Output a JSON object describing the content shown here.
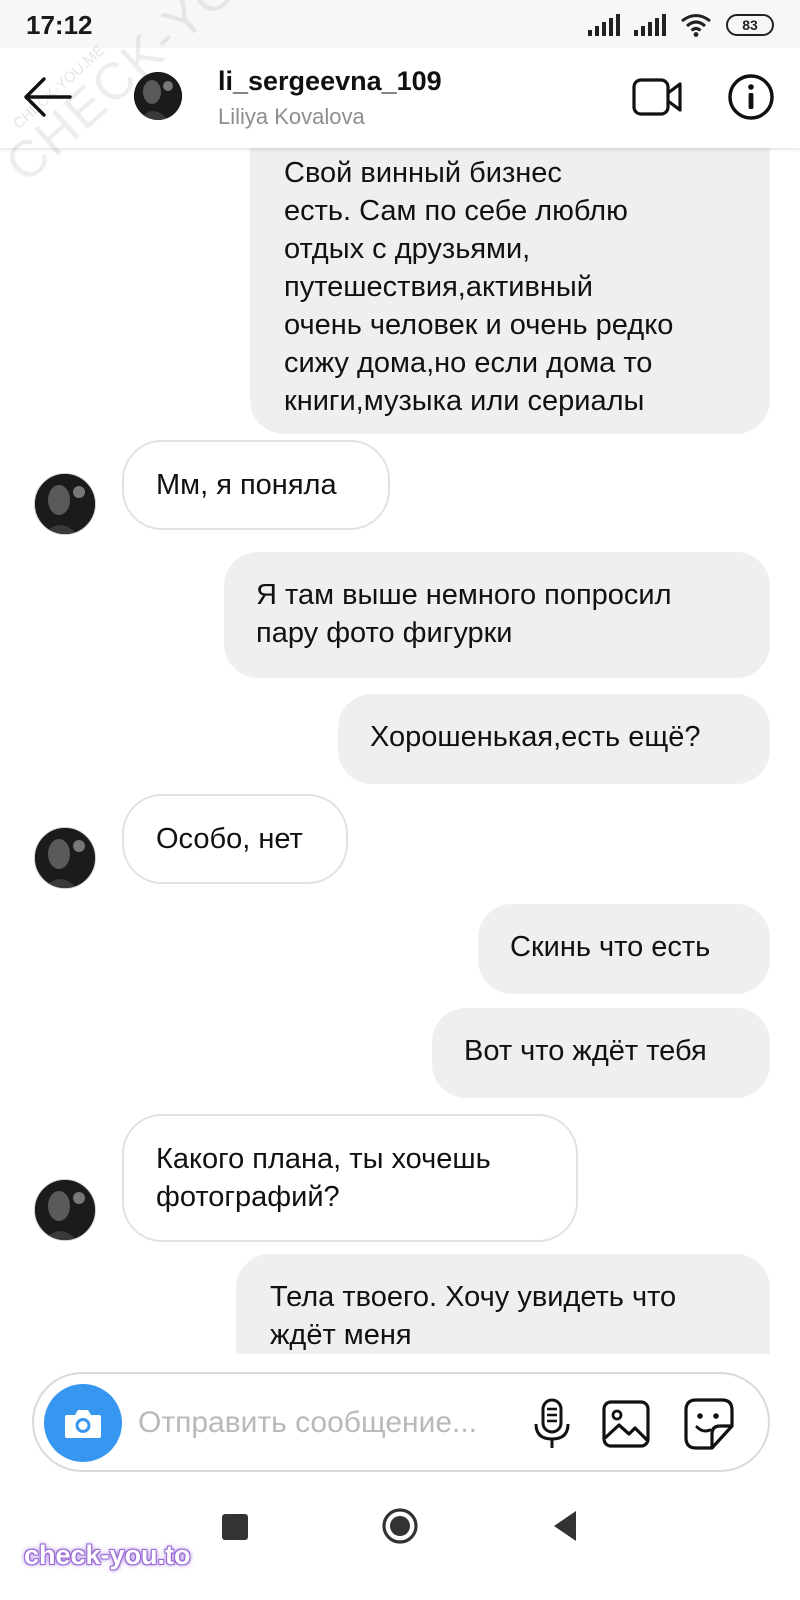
{
  "status_bar": {
    "time": "17:12",
    "battery": "83",
    "icons": [
      "signal-icon",
      "signal-icon",
      "wifi-icon",
      "battery-icon"
    ]
  },
  "header": {
    "username": "li_sergeevna_109",
    "full_name": "Liliya Kovalova",
    "icons": [
      "back-arrow-icon",
      "video-call-icon",
      "info-icon"
    ]
  },
  "messages": [
    {
      "sender": "me",
      "lines": [
        "Свой винный бизнес",
        "есть. Сам по себе люблю",
        "отдых с друзьями,",
        "путешествия,активный",
        "очень человек и очень редко",
        "сижу дома,но если дома то",
        "книги,музыка или сериалы"
      ]
    },
    {
      "sender": "them",
      "lines": [
        "Мм, я поняла"
      ]
    },
    {
      "sender": "me",
      "lines": [
        "Я там выше немного попросил",
        "пару фото фигурки"
      ]
    },
    {
      "sender": "me",
      "lines": [
        "Хорошенькая,есть ещё?"
      ]
    },
    {
      "sender": "them",
      "lines": [
        "Особо, нет"
      ]
    },
    {
      "sender": "me",
      "lines": [
        "Скинь что есть"
      ]
    },
    {
      "sender": "me",
      "lines": [
        "Вот что ждёт тебя"
      ]
    },
    {
      "sender": "them",
      "lines": [
        "Какого плана, ты хочешь",
        "фотографий?"
      ]
    },
    {
      "sender": "me",
      "lines": [
        "Тела твоего. Хочу увидеть что",
        "ждёт меня"
      ]
    }
  ],
  "composer": {
    "placeholder": "Отправить сообщение...",
    "icons": [
      "camera-icon",
      "microphone-icon",
      "gallery-icon",
      "sticker-icon"
    ]
  },
  "nav_bar": {
    "icons": [
      "recents-square-icon",
      "home-circle-icon",
      "back-triangle-icon"
    ]
  },
  "watermarks": {
    "diagonal": "CHECK-YOU.ME",
    "small": "CHECK-YOU.ME",
    "bottom": "check-you.to"
  },
  "colors": {
    "accent_blue": "#3797f0",
    "outgoing_bubble": "#efefef",
    "incoming_border": "#e2e2e2",
    "secondary_text": "#8e8e8e",
    "watermark_purple": "#9b6bd6"
  }
}
